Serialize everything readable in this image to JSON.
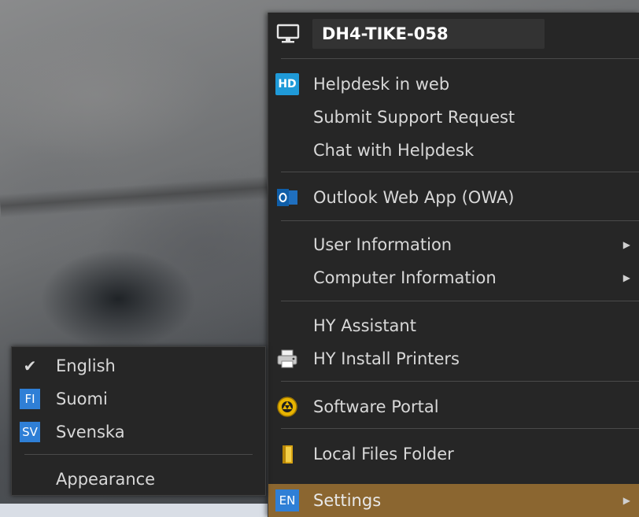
{
  "computer_name": "DH4-TIKE-058",
  "menu": {
    "helpdesk_web": "Helpdesk in web",
    "submit_request": "Submit Support Request",
    "chat_helpdesk": "Chat with Helpdesk",
    "owa": "Outlook Web App (OWA)",
    "user_info": "User Information",
    "computer_info": "Computer Information",
    "hy_assistant": "HY Assistant",
    "hy_printers": "HY Install Printers",
    "software_portal": "Software Portal",
    "local_files": "Local Files Folder",
    "settings": "Settings"
  },
  "icons": {
    "helpdesk_badge": "HD",
    "settings_badge": "EN"
  },
  "submenu": {
    "english": "English",
    "suomi": "Suomi",
    "suomi_badge": "FI",
    "svenska": "Svenska",
    "svenska_badge": "SV",
    "appearance": "Appearance",
    "checkmark": "✔"
  },
  "colors": {
    "menu_bg": "#262626",
    "active_highlight": "#8b6630",
    "badge_blue": "#2f7fd6"
  }
}
